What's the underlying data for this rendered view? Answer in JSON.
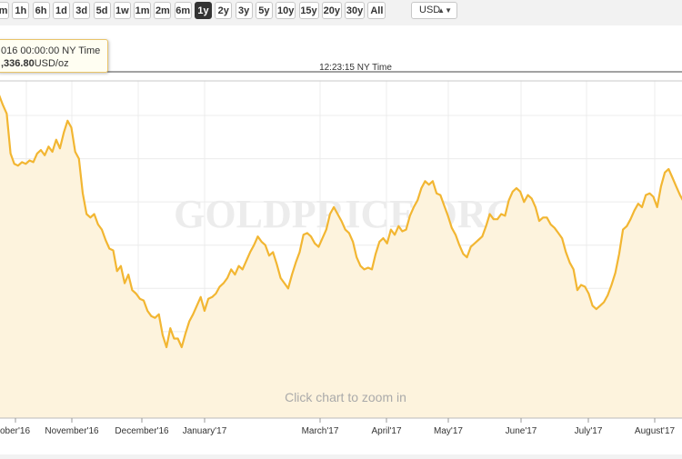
{
  "toolbar": {
    "ranges": [
      {
        "label": "m",
        "active": false
      },
      {
        "label": "1h",
        "active": false
      },
      {
        "label": "6h",
        "active": false
      },
      {
        "label": "1d",
        "active": false
      },
      {
        "label": "3d",
        "active": false
      },
      {
        "label": "5d",
        "active": false
      },
      {
        "label": "1w",
        "active": false
      },
      {
        "label": "1m",
        "active": false
      },
      {
        "label": "2m",
        "active": false
      },
      {
        "label": "6m",
        "active": false
      },
      {
        "label": "1y",
        "active": true
      },
      {
        "label": "2y",
        "active": false
      },
      {
        "label": "3y",
        "active": false
      },
      {
        "label": "5y",
        "active": false
      },
      {
        "label": "10y",
        "active": false
      },
      {
        "label": "15y",
        "active": false
      },
      {
        "label": "20y",
        "active": false
      },
      {
        "label": "30y",
        "active": false
      },
      {
        "label": "All",
        "active": false
      }
    ],
    "currency": "USD"
  },
  "tooltip": {
    "date": "016 00:00:00 NY Time",
    "value": ",336.80",
    "unit": "USD/oz"
  },
  "timestamp": "12:23:15 NY Time",
  "watermark": "GOLDPRICE.ORG",
  "hint": "Click chart to zoom in",
  "colors": {
    "line": "#f2b632",
    "fill": "#fdf3dd",
    "active_button": "#333333"
  },
  "chart_data": {
    "type": "area",
    "x_tick_labels": [
      "ober'16",
      "November'16",
      "December'16",
      "January'17",
      "March'17",
      "April'17",
      "May'17",
      "June'17",
      "July'17",
      "August'17"
    ],
    "series": [
      {
        "values": [
          1336.8,
          1331,
          1326,
          1303,
          1297,
          1296,
          1298,
          1297,
          1299,
          1298,
          1303,
          1305,
          1302,
          1307,
          1304,
          1311,
          1306,
          1315,
          1322,
          1318,
          1304,
          1300,
          1280,
          1268,
          1266,
          1268,
          1262,
          1259,
          1253,
          1248,
          1247,
          1235,
          1238,
          1228,
          1233,
          1224,
          1222,
          1219,
          1218,
          1212,
          1209,
          1208,
          1210,
          1198,
          1191,
          1202,
          1196,
          1196,
          1191,
          1199,
          1206,
          1210,
          1215,
          1220,
          1212,
          1219,
          1220,
          1222,
          1226,
          1228,
          1231,
          1236,
          1233,
          1238,
          1236,
          1241,
          1246,
          1250,
          1255,
          1252,
          1250,
          1244,
          1246,
          1239,
          1231,
          1228,
          1225,
          1233,
          1240,
          1246,
          1256,
          1257,
          1255,
          1251,
          1249,
          1254,
          1259,
          1268,
          1272,
          1268,
          1264,
          1259,
          1257,
          1252,
          1243,
          1238,
          1236,
          1237,
          1236,
          1245,
          1252,
          1254,
          1251,
          1259,
          1256,
          1261,
          1258,
          1259,
          1267,
          1272,
          1276,
          1283,
          1287,
          1285,
          1287,
          1280,
          1279,
          1273,
          1267,
          1260,
          1256,
          1250,
          1245,
          1243,
          1249,
          1251,
          1253,
          1255,
          1261,
          1268,
          1265,
          1265,
          1268,
          1267,
          1276,
          1281,
          1283,
          1281,
          1275,
          1279,
          1277,
          1272,
          1264,
          1266,
          1266,
          1262,
          1260,
          1257,
          1254,
          1246,
          1240,
          1236,
          1224,
          1227,
          1226,
          1222,
          1215,
          1213,
          1215,
          1217,
          1221,
          1227,
          1234,
          1245,
          1259,
          1261,
          1265,
          1270,
          1274,
          1272,
          1279,
          1280,
          1278,
          1272,
          1284,
          1292,
          1294,
          1289,
          1284,
          1279,
          1275
        ]
      }
    ],
    "ylim": [
      1150,
      1345
    ],
    "grid": true,
    "watermark_visible": true
  }
}
